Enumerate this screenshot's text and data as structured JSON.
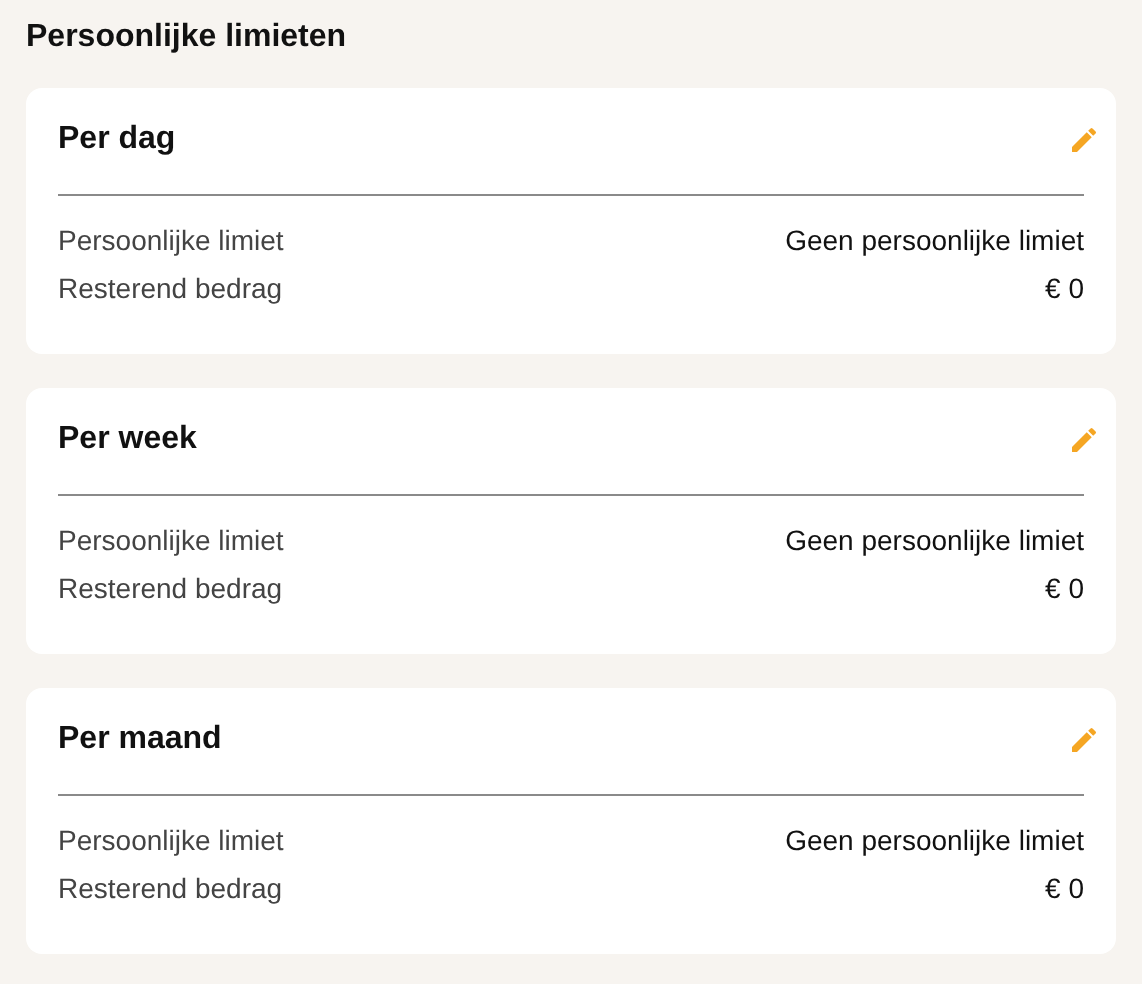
{
  "title": "Persoonlijke limieten",
  "cards": [
    {
      "heading": "Per dag",
      "rows": [
        {
          "label": "Persoonlijke limiet",
          "value": "Geen persoonlijke limiet"
        },
        {
          "label": "Resterend bedrag",
          "value": "€ 0"
        }
      ]
    },
    {
      "heading": "Per week",
      "rows": [
        {
          "label": "Persoonlijke limiet",
          "value": "Geen persoonlijke limiet"
        },
        {
          "label": "Resterend bedrag",
          "value": "€ 0"
        }
      ]
    },
    {
      "heading": "Per maand",
      "rows": [
        {
          "label": "Persoonlijke limiet",
          "value": "Geen persoonlijke limiet"
        },
        {
          "label": "Resterend bedrag",
          "value": "€ 0"
        }
      ]
    }
  ]
}
